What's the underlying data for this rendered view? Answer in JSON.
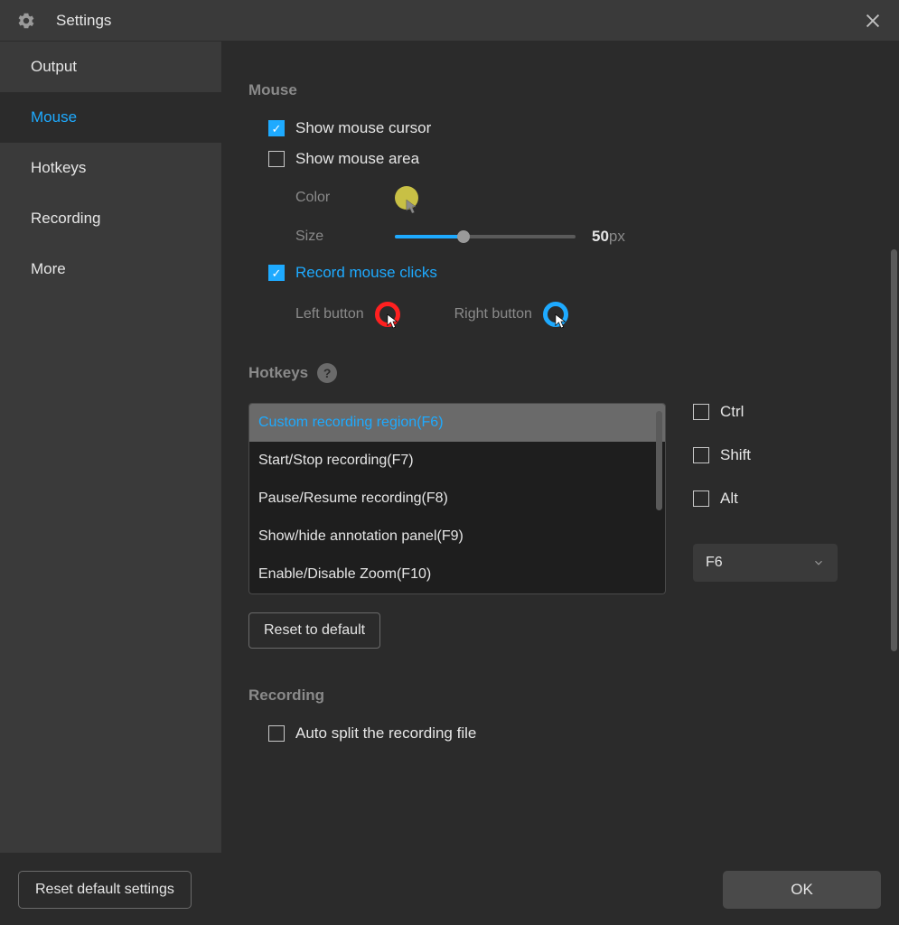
{
  "window": {
    "title": "Settings"
  },
  "sidebar": {
    "items": [
      {
        "label": "Output"
      },
      {
        "label": "Mouse"
      },
      {
        "label": "Hotkeys"
      },
      {
        "label": "Recording"
      },
      {
        "label": "More"
      }
    ],
    "active_index": 1
  },
  "mouse": {
    "section_title": "Mouse",
    "show_cursor": {
      "label": "Show mouse cursor",
      "checked": true
    },
    "show_area": {
      "label": "Show mouse area",
      "checked": false
    },
    "color_label": "Color",
    "color_value": "#c8c045",
    "size_label": "Size",
    "size_value": "50",
    "size_unit": "px",
    "size_percent": 38,
    "record_clicks": {
      "label": "Record mouse clicks",
      "checked": true
    },
    "left_button_label": "Left button",
    "left_button_color": "#ff2020",
    "right_button_label": "Right button",
    "right_button_color": "#1eaaff"
  },
  "hotkeys": {
    "section_title": "Hotkeys",
    "list": [
      "Custom recording region(F6)",
      "Start/Stop recording(F7)",
      "Pause/Resume recording(F8)",
      "Show/hide annotation panel(F9)",
      "Enable/Disable Zoom(F10)"
    ],
    "selected_index": 0,
    "mods": {
      "ctrl": {
        "label": "Ctrl",
        "checked": false
      },
      "shift": {
        "label": "Shift",
        "checked": false
      },
      "alt": {
        "label": "Alt",
        "checked": false
      }
    },
    "key_select": "F6",
    "reset_label": "Reset to default"
  },
  "recording": {
    "section_title": "Recording",
    "auto_split": {
      "label": "Auto split the recording file",
      "checked": false
    }
  },
  "footer": {
    "reset_label": "Reset default settings",
    "ok_label": "OK"
  }
}
